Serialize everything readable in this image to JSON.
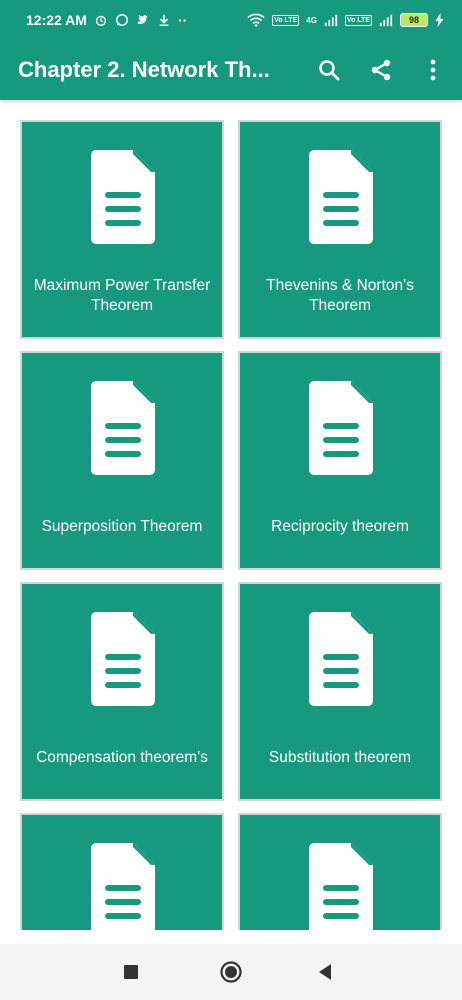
{
  "status_bar": {
    "time": "12:22 AM",
    "dots": "··",
    "lte1": "Vo LTE",
    "lte2": "Vo LTE",
    "net": "4G",
    "battery": "98"
  },
  "app_bar": {
    "title": "Chapter 2. Network Th...",
    "actions": [
      "search-icon",
      "share-icon",
      "overflow-menu-icon"
    ]
  },
  "cards": [
    {
      "label": "Maximum Power Transfer Theorem",
      "icon": "document-icon"
    },
    {
      "label": "Thevenins & Norton's Theorem",
      "icon": "document-icon"
    },
    {
      "label": "Superposition Theorem",
      "icon": "document-icon"
    },
    {
      "label": "Reciprocity theorem",
      "icon": "document-icon"
    },
    {
      "label": "Compensation theorem's",
      "icon": "document-icon"
    },
    {
      "label": "Substitution theorem",
      "icon": "document-icon"
    },
    {
      "label": "",
      "icon": "document-icon"
    },
    {
      "label": "",
      "icon": "document-icon"
    }
  ],
  "nav_bar": [
    "recents-square-icon",
    "home-circle-icon",
    "back-triangle-icon"
  ],
  "colors": {
    "primary": "#16997e",
    "card_border": "#cfd6d4",
    "battery": "#b9e86a"
  }
}
